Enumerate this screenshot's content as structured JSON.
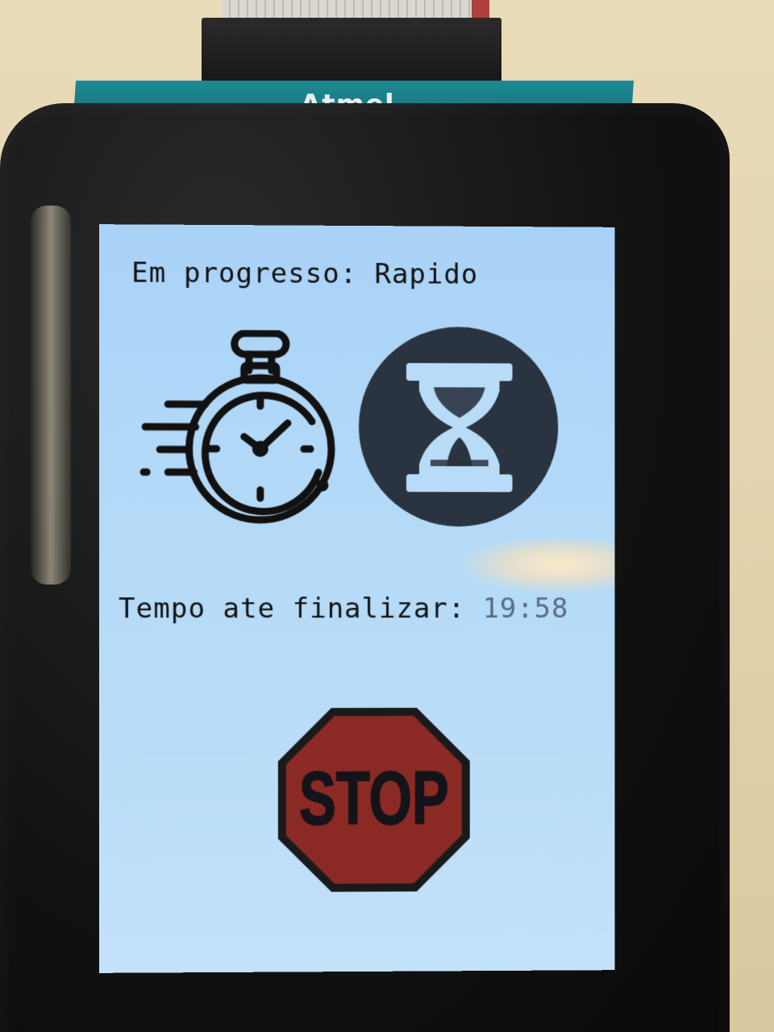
{
  "device": {
    "board_logo": "Atmel"
  },
  "screen": {
    "status_prefix": "Em progresso:",
    "status_mode": "Rapido",
    "time_label": "Tempo ate finalizar:",
    "time_remaining": "19:58",
    "stop_label": "STOP"
  },
  "colors": {
    "screen_bg": "#b4daf8",
    "stop_red": "#8b2a24",
    "text": "#111111",
    "hourglass_circle": "#2a3340"
  },
  "icons": [
    "stopwatch-icon",
    "hourglass-icon",
    "stop-sign-icon"
  ]
}
